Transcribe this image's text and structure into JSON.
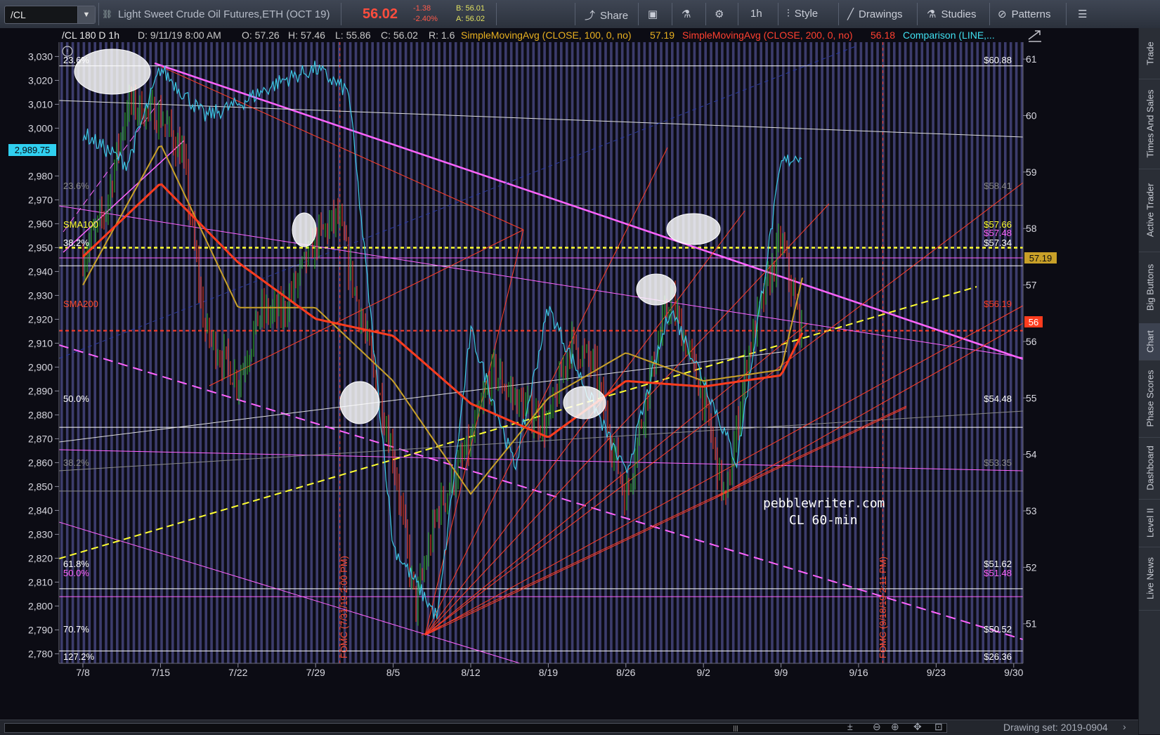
{
  "topbar": {
    "symbol": "/CL",
    "contract_title": "Light Sweet Crude Oil Futures,ETH (OCT 19)",
    "last_price": "56.02",
    "net_change": "-1.38",
    "pct_change": "-2.40%",
    "bid": "B: 56.01",
    "ask": "A: 56.02",
    "share_label": "Share",
    "timeframe_label": "1h",
    "style_label": "Style",
    "drawings_label": "Drawings",
    "studies_label": "Studies",
    "patterns_label": "Patterns"
  },
  "info_bar": {
    "symbol_period": "/CL 180 D 1h",
    "date": "D: 9/11/19 8:00 AM",
    "open": "O: 57.26",
    "high": "H: 57.46",
    "low": "L: 55.86",
    "close": "C: 56.02",
    "range": "R: 1.6",
    "sma100": "SimpleMovingAvg (CLOSE, 100, 0, no)",
    "sma100_value": "57.19",
    "sma200": "SimpleMovingAvg (CLOSE, 200, 0, no)",
    "sma200_value": "56.18",
    "comparison": "Comparison (LINE,..."
  },
  "left_axis": {
    "ticks": [
      "3,030",
      "3,020",
      "3,010",
      "3,000",
      "2,980",
      "2,970",
      "2,960",
      "2,950",
      "2,940",
      "2,930",
      "2,920",
      "2,910",
      "2,900",
      "2,890",
      "2,880",
      "2,870",
      "2,860",
      "2,850",
      "2,840",
      "2,830",
      "2,820",
      "2,810",
      "2,800",
      "2,790",
      "2,780"
    ],
    "current_marker": "2,989.75"
  },
  "right_axis": {
    "ticks": [
      "61",
      "60",
      "59",
      "58",
      "57",
      "56",
      "55",
      "54",
      "53",
      "52",
      "51"
    ],
    "sma100_marker": "57.19",
    "price_marker": "56"
  },
  "x_axis": {
    "ticks": [
      "7/8",
      "7/15",
      "7/22",
      "7/29",
      "8/5",
      "8/12",
      "8/19",
      "8/26",
      "9/2",
      "9/9",
      "9/16",
      "9/23",
      "9/30"
    ]
  },
  "fib_labels": {
    "left": [
      "23.6%",
      "23.6%",
      "38.2%",
      "50.0%",
      "38.2%",
      "61.8%",
      "50.0%",
      "70.7%",
      "127.2%"
    ],
    "right": [
      "$60.88",
      "$58.41",
      "$57.66",
      "$57.48",
      "$57.34",
      "$56.19",
      "$54.48",
      "$53.35",
      "$51.62",
      "$51.48",
      "$50.52",
      "$26.36"
    ]
  },
  "chart_labels": {
    "sma100": "SMA100",
    "sma200": "SMA200",
    "fomc_july": "FOMC (7/31/19 2:00 PM)",
    "fomc_sept": "FOMC (9/18/19 2:11 PM)",
    "watermark_line1": "pebblewriter.com",
    "watermark_line2": "CL 60-min"
  },
  "side_tabs": [
    "Trade",
    "Times And Sales",
    "Active Trader",
    "Big Buttons",
    "Chart",
    "Phase Scores",
    "Dashboard",
    "Level II",
    "Live News"
  ],
  "active_side_tab": "Chart",
  "bottom": {
    "drawing_set": "Drawing set: 2019-0904"
  },
  "colors": {
    "background": "#0c0c14",
    "stripe": "#3c3c6c",
    "price_cyan": "#3cc8e6",
    "sma100": "#c8a028",
    "sma200": "#ff3c1e",
    "magenta": "#ff64ff",
    "fib_yellow": "#ffff30",
    "down_red": "#ff3c28",
    "up_green": "#2ab82a"
  },
  "chart_data": {
    "type": "line",
    "title": "",
    "xlabel": "",
    "ylabel": "",
    "x_ticks": [
      "7/8",
      "7/15",
      "7/22",
      "7/29",
      "8/5",
      "8/12",
      "8/19",
      "8/26",
      "9/2",
      "9/9",
      "9/16",
      "9/23",
      "9/30"
    ],
    "ylim": [
      50.3,
      61.3
    ],
    "secondary_ylim": [
      2776,
      3036
    ],
    "series": [
      {
        "name": "/CL",
        "x": [
          "7/8",
          "7/10",
          "7/12",
          "7/15",
          "7/17",
          "7/19",
          "7/22",
          "7/24",
          "7/26",
          "7/29",
          "7/31",
          "8/2",
          "8/5",
          "8/7",
          "8/9",
          "8/12",
          "8/14",
          "8/16",
          "8/19",
          "8/21",
          "8/23",
          "8/26",
          "8/28",
          "8/30",
          "9/2",
          "9/4",
          "9/6",
          "9/9",
          "9/11"
        ],
        "values": [
          57.5,
          58.3,
          60.2,
          60.0,
          59.3,
          56.2,
          55.3,
          56.5,
          56.5,
          57.8,
          58.2,
          56.5,
          54.0,
          51.3,
          53.0,
          54.2,
          55.5,
          55.0,
          54.5,
          56.0,
          55.6,
          53.2,
          55.2,
          56.8,
          55.0,
          53.1,
          55.8,
          57.8,
          56.02
        ]
      },
      {
        "name": "SimpleMovingAvg (CLOSE, 100, 0, no)",
        "x": [
          "7/8",
          "7/15",
          "7/22",
          "7/29",
          "8/5",
          "8/12",
          "8/19",
          "8/26",
          "9/2",
          "9/9",
          "9/11"
        ],
        "values": [
          57.0,
          59.5,
          56.6,
          56.6,
          55.3,
          53.3,
          55.0,
          55.8,
          55.3,
          55.5,
          57.19
        ]
      },
      {
        "name": "SimpleMovingAvg (CLOSE, 200, 0, no)",
        "x": [
          "7/8",
          "7/15",
          "7/22",
          "7/29",
          "8/5",
          "8/12",
          "8/19",
          "8/26",
          "9/2",
          "9/9",
          "9/11"
        ],
        "values": [
          57.5,
          58.8,
          57.4,
          56.4,
          56.1,
          54.9,
          54.3,
          55.3,
          55.2,
          55.4,
          56.18
        ]
      },
      {
        "name": "Comparison (LINE,...",
        "x": [
          "7/8",
          "7/12",
          "7/15",
          "7/19",
          "7/22",
          "7/26",
          "7/29",
          "8/1",
          "8/5",
          "8/9",
          "8/12",
          "8/16",
          "8/19",
          "8/23",
          "8/26",
          "8/30",
          "9/2",
          "9/5",
          "9/9",
          "9/11"
        ],
        "values": [
          2998,
          2985,
          3025,
          3005,
          3010,
          3020,
          3025,
          3015,
          2825,
          2795,
          2915,
          2858,
          2925,
          2885,
          2855,
          2925,
          2895,
          2860,
          2985,
          2989.75
        ]
      }
    ]
  }
}
